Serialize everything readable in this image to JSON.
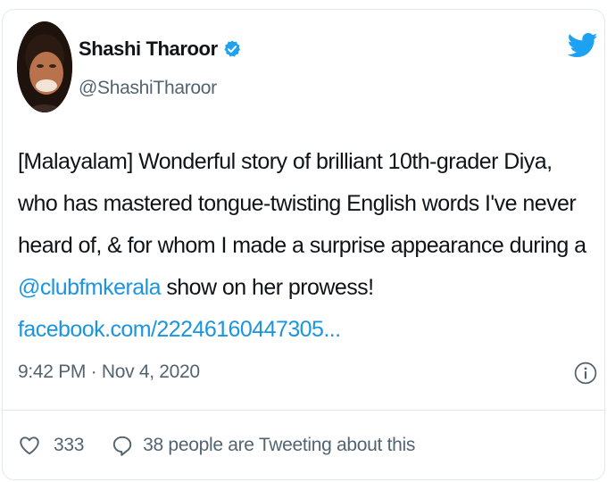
{
  "author": {
    "name": "Shashi Tharoor",
    "handle": "@ShashiTharoor",
    "verified": true
  },
  "tweet": {
    "line1": "[Malayalam] Wonderful story of brilliant 10th-grader Diya,",
    "line2": "who has mastered tongue-twisting English words I've never",
    "line3": "heard of, & for whom I made a surprise appearance during a",
    "mention": "@clubfmkerala",
    "line4_rest": " show on her prowess!",
    "link": "facebook.com/22246160447305..."
  },
  "meta": {
    "timestamp": "9:42 PM · Nov 4, 2020"
  },
  "footer": {
    "likes": "333",
    "replies": "38 people are Tweeting about this"
  },
  "colors": {
    "link": "#1b95e0",
    "twitter_blue": "#1da1f2",
    "muted": "#536471",
    "border": "#e1e8ed"
  }
}
